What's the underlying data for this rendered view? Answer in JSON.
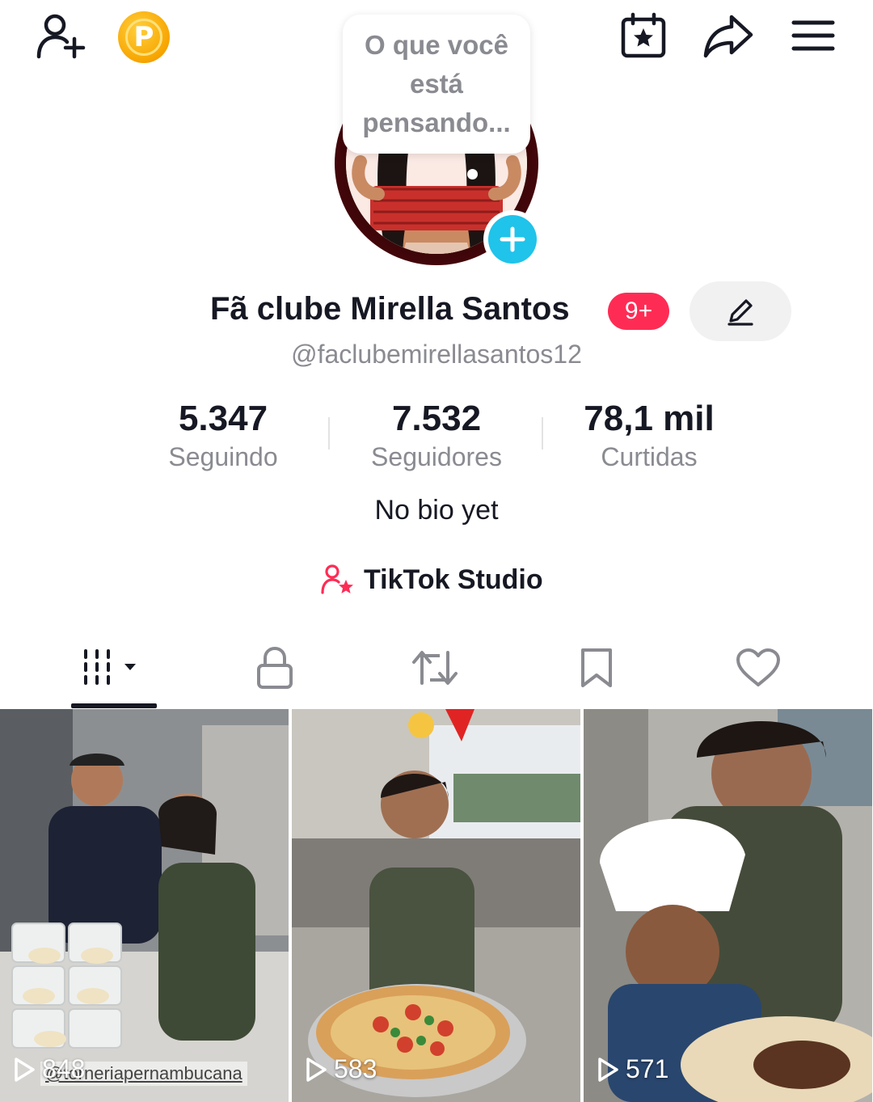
{
  "top_bar": {
    "add_friend_icon": "person-plus-icon",
    "coin_letter": "P",
    "calendar_icon": "calendar-star-icon",
    "share_icon": "share-arrow-icon",
    "menu_icon": "hamburger-menu-icon"
  },
  "avatar": {
    "thought_bubble": "O que você está pensando...",
    "add_icon": "plus-icon"
  },
  "profile": {
    "display_name": "Fã clube Mirella Santos",
    "badge": "9+",
    "username": "@faclubemirellasantos12",
    "bio": "No bio yet",
    "studio_label": "TikTok Studio"
  },
  "stats": [
    {
      "value": "5.347",
      "label": "Seguindo"
    },
    {
      "value": "7.532",
      "label": "Seguidores"
    },
    {
      "value": "78,1 mil",
      "label": "Curtidas"
    }
  ],
  "tabs": [
    "videos-grid",
    "private",
    "reposts",
    "favorites",
    "liked"
  ],
  "videos": [
    {
      "views": "848",
      "watermark": "@torneriapernambucana"
    },
    {
      "views": "583"
    },
    {
      "views": "571"
    }
  ],
  "colors": {
    "accent": "#fe2c55",
    "add_blue": "#20c3ea",
    "text": "#161823",
    "muted": "#8a8b91"
  }
}
